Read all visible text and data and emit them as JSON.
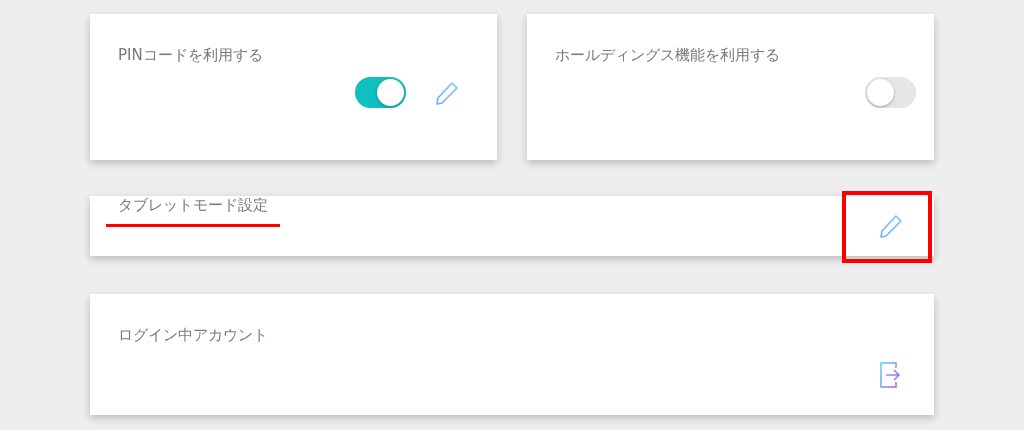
{
  "cards": [
    {
      "kind": "toggle",
      "title": "PINコードを利用する",
      "on": true,
      "editable": true
    },
    {
      "kind": "toggle",
      "title": "ホールディングス機能を利用する",
      "on": false,
      "editable": false
    },
    {
      "kind": "edit",
      "title": "タブレットモード設定",
      "underlined": true,
      "highlighted": true
    },
    {
      "kind": "logout",
      "title": "ログイン中アカウント"
    }
  ]
}
